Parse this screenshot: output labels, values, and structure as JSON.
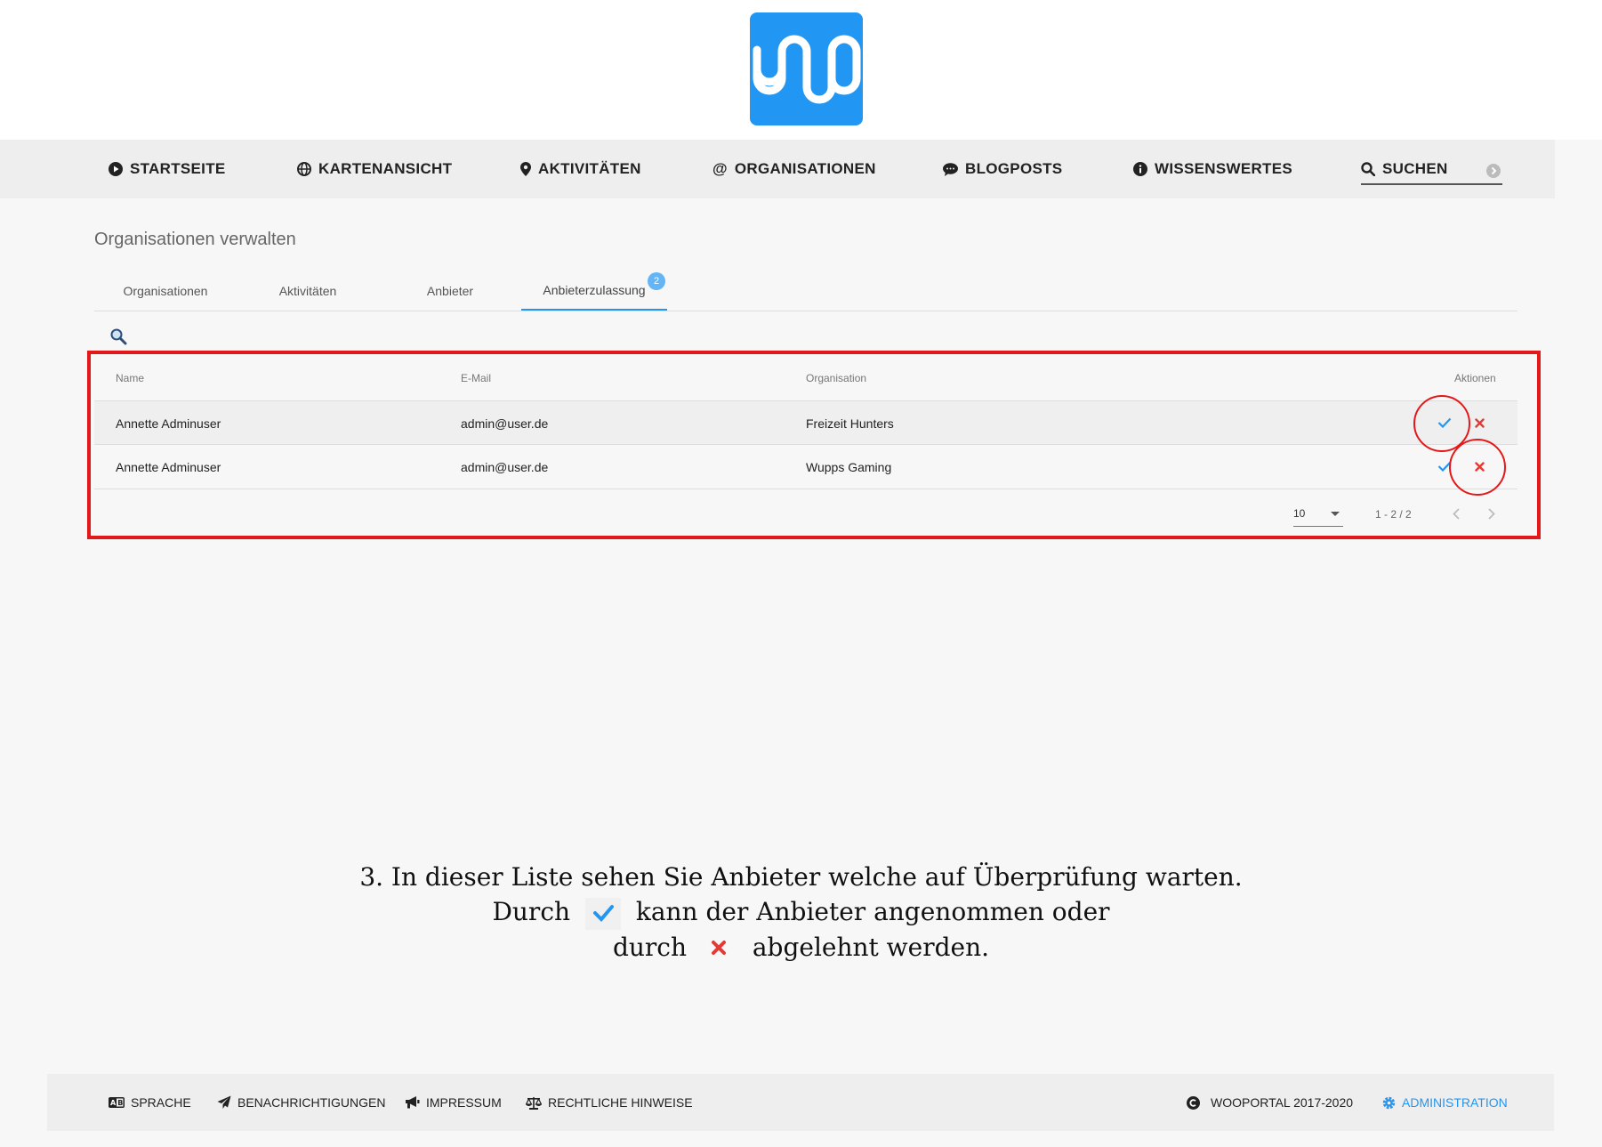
{
  "nav": {
    "items": [
      {
        "label": "STARTSEITE",
        "icon": "play-circle-icon"
      },
      {
        "label": "KARTENANSICHT",
        "icon": "globe-icon"
      },
      {
        "label": "AKTIVITÄTEN",
        "icon": "map-marker-icon"
      },
      {
        "label": "ORGANISATIONEN",
        "icon": "at-icon"
      },
      {
        "label": "BLOGPOSTS",
        "icon": "comment-icon"
      },
      {
        "label": "WISSENSWERTES",
        "icon": "info-circle-icon"
      }
    ],
    "search_label": "SUCHEN"
  },
  "page": {
    "title": "Organisationen verwalten"
  },
  "tabs": [
    {
      "label": "Organisationen"
    },
    {
      "label": "Aktivitäten"
    },
    {
      "label": "Anbieter"
    },
    {
      "label": "Anbieterzulassung",
      "badge": "2",
      "active": true
    }
  ],
  "table": {
    "headers": {
      "name": "Name",
      "email": "E-Mail",
      "organisation": "Organisation",
      "actions": "Aktionen"
    },
    "rows": [
      {
        "name": "Annette Adminuser",
        "email": "admin@user.de",
        "organisation": "Freizeit Hunters"
      },
      {
        "name": "Annette Adminuser",
        "email": "admin@user.de",
        "organisation": "Wupps Gaming"
      }
    ],
    "pagination": {
      "per_page": "10",
      "range": "1 - 2 / 2"
    }
  },
  "caption": {
    "line1": "3. In dieser Liste sehen Sie Anbieter welche auf Überprüfung warten.",
    "line2_a": "Durch",
    "line2_b": "kann der Anbieter angenommen oder",
    "line3_a": "durch",
    "line3_b": "abgelehnt werden."
  },
  "footer": {
    "sprache": "SPRACHE",
    "benachrichtigungen": "BENACHRICHTIGUNGEN",
    "impressum": "IMPRESSUM",
    "rechtliche_hinweise": "RECHTLICHE HINWEISE",
    "copyright": "WOOPORTAL 2017-2020",
    "administration": "ADMINISTRATION"
  },
  "colors": {
    "brand": "#2196f3",
    "accept": "#2196f3",
    "reject": "#e53935",
    "highlight": "#e41818"
  }
}
